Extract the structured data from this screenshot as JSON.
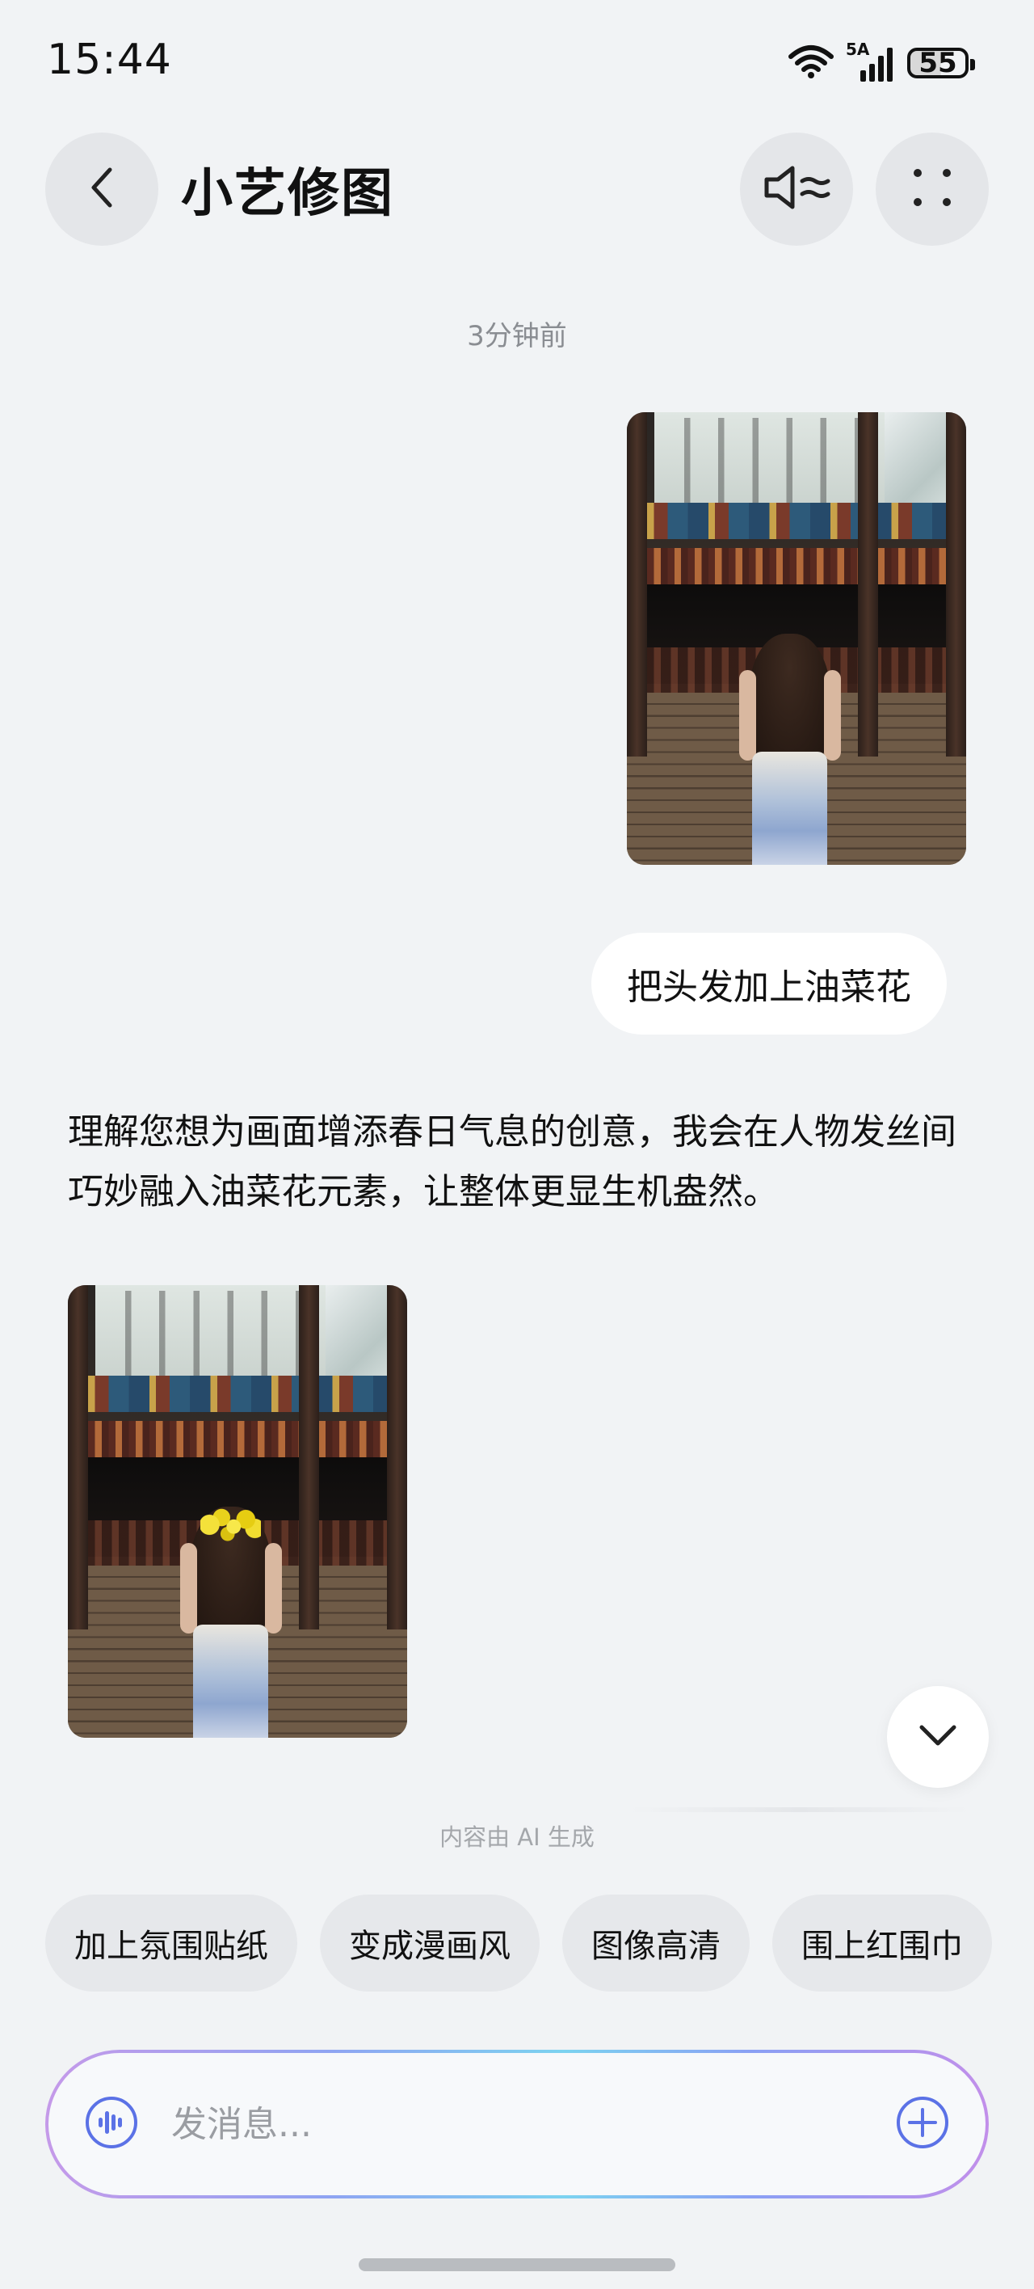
{
  "status_bar": {
    "time": "15:44",
    "network": "5A",
    "battery": "55"
  },
  "header": {
    "title": "小艺修图",
    "back_icon": "chevron-left-icon",
    "speaker_icon": "speaker-mode-icon",
    "more_icon": "more-grid-icon"
  },
  "chat": {
    "timestamp": "3分钟前",
    "user_message": "把头发加上油菜花",
    "ai_reply": "理解您想为画面增添春日气息的创意，我会在人物发丝间巧妙融入油菜花元素，让整体更显生机盎然。",
    "ai_notice": "内容由 AI 生成"
  },
  "suggestions": [
    {
      "label": "加上氛围贴纸"
    },
    {
      "label": "变成漫画风"
    },
    {
      "label": "图像高清"
    },
    {
      "label": "围上红围巾"
    }
  ],
  "composer": {
    "placeholder": "发消息...",
    "voice_icon": "voice-wave-icon",
    "add_icon": "plus-circle-icon"
  },
  "colors": {
    "background": "#f1f3f5",
    "accent": "#5b72e6"
  }
}
